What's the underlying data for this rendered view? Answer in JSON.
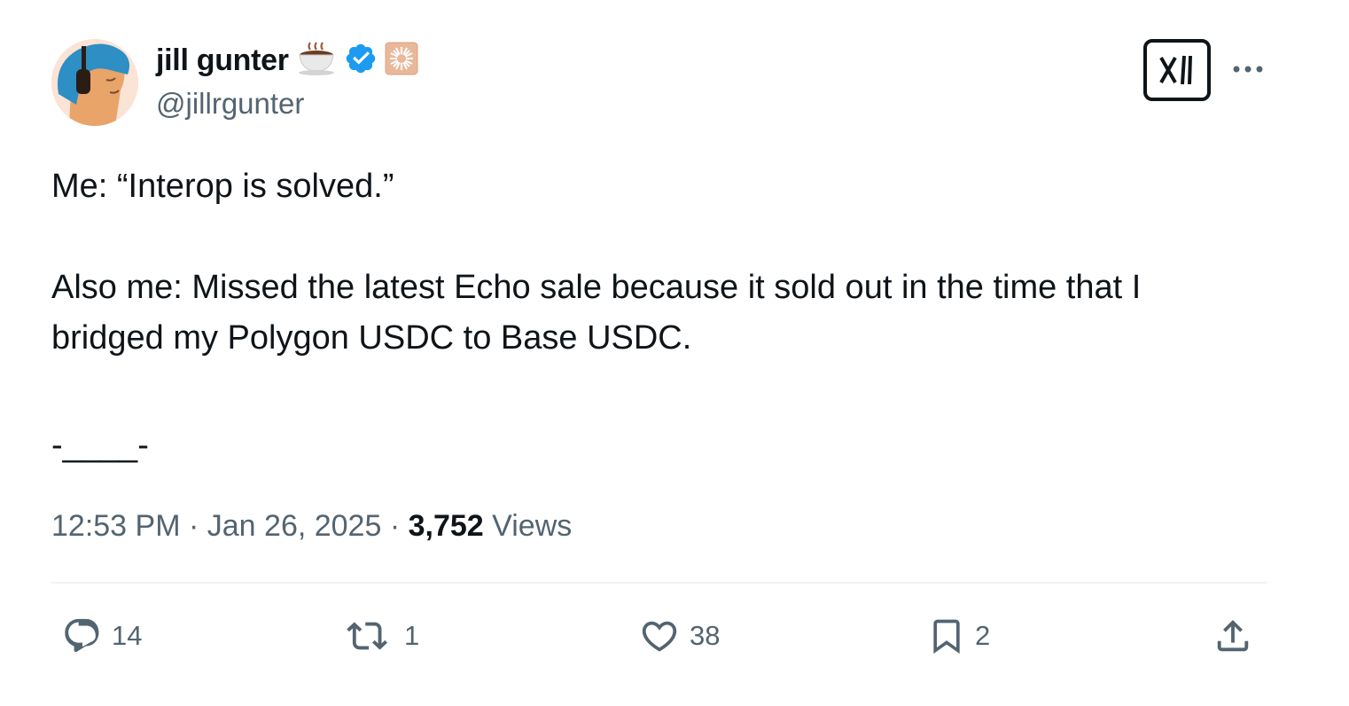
{
  "author": {
    "display_name": "jill gunter",
    "handle": "@jillrgunter",
    "verified": true,
    "avatar_icon": "avatar-illustration",
    "badges": [
      "coffee-emoji-icon",
      "verified-badge-icon",
      "affiliate-badge-icon"
    ]
  },
  "header": {
    "grok_icon": "grok-icon",
    "more_icon": "more-icon"
  },
  "tweet": {
    "line1": "Me: “Interop is solved.”",
    "line2": "Also me: Missed the latest Echo sale because it sold out in the time that I",
    "line3": "bridged my Polygon USDC to Base USDC.",
    "line4": "-____-"
  },
  "meta": {
    "time": "12:53 PM",
    "date": "Jan 26, 2025",
    "separator": "·",
    "views_count": "3,752",
    "views_label": "Views"
  },
  "actions": {
    "replies": "14",
    "retweets": "1",
    "likes": "38",
    "bookmarks": "2"
  },
  "colors": {
    "text": "#0f1419",
    "secondary": "#536471",
    "verified": "#1d9bf0",
    "divider": "#eff3f4"
  }
}
